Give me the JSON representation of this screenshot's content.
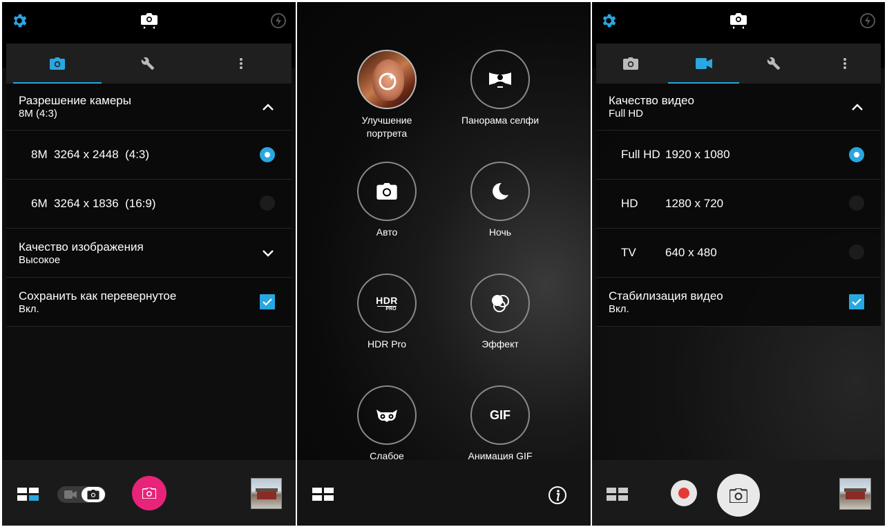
{
  "panel1": {
    "tabs": [
      "camera-icon",
      "wrench-icon",
      "more-vert-icon"
    ],
    "settings": {
      "resolution": {
        "title": "Разрешение камеры",
        "value": "8M (4:3)"
      },
      "res_options": [
        {
          "label": "8M  3264 x 2448  (4:3)",
          "selected": true
        },
        {
          "label": "6M  3264 x 1836  (16:9)",
          "selected": false
        }
      ],
      "quality": {
        "title": "Качество изображения",
        "value": "Высокое"
      },
      "flip": {
        "title": "Сохранить как перевернутое",
        "value": "Вкл.",
        "checked": true
      }
    },
    "bottom": {
      "thumb_alt": "gallery-thumbnail"
    }
  },
  "panel2": {
    "modes": [
      {
        "label": "Улучшение\nпортрета",
        "icon": "portrait-beauty-icon"
      },
      {
        "label": "Панорама селфи",
        "icon": "selfie-panorama-icon"
      },
      {
        "label": "Авто",
        "icon": "camera-icon"
      },
      {
        "label": "Ночь",
        "icon": "moon-icon"
      },
      {
        "label": "HDR Pro",
        "icon": "hdr-pro-icon",
        "icon_text": "HDR",
        "icon_sub": "PRO"
      },
      {
        "label": "Эффект",
        "icon": "effect-icon"
      },
      {
        "label": "Слабое",
        "icon": "owl-icon"
      },
      {
        "label": "Анимация GIF",
        "icon": "gif-icon",
        "icon_text": "GIF"
      }
    ]
  },
  "panel3": {
    "settings": {
      "video_quality": {
        "title": "Качество видео",
        "value": "Full HD"
      },
      "options": [
        {
          "name": "Full HD",
          "res": "1920 x 1080",
          "selected": true
        },
        {
          "name": "HD",
          "res": "1280 x 720",
          "selected": false
        },
        {
          "name": "TV",
          "res": "640 x 480",
          "selected": false
        }
      ],
      "stabilization": {
        "title": "Стабилизация видео",
        "value": "Вкл.",
        "checked": true
      }
    }
  },
  "colors": {
    "accent": "#29a7e1",
    "shutter_pink": "#e8237a",
    "record_red": "#e53935"
  }
}
